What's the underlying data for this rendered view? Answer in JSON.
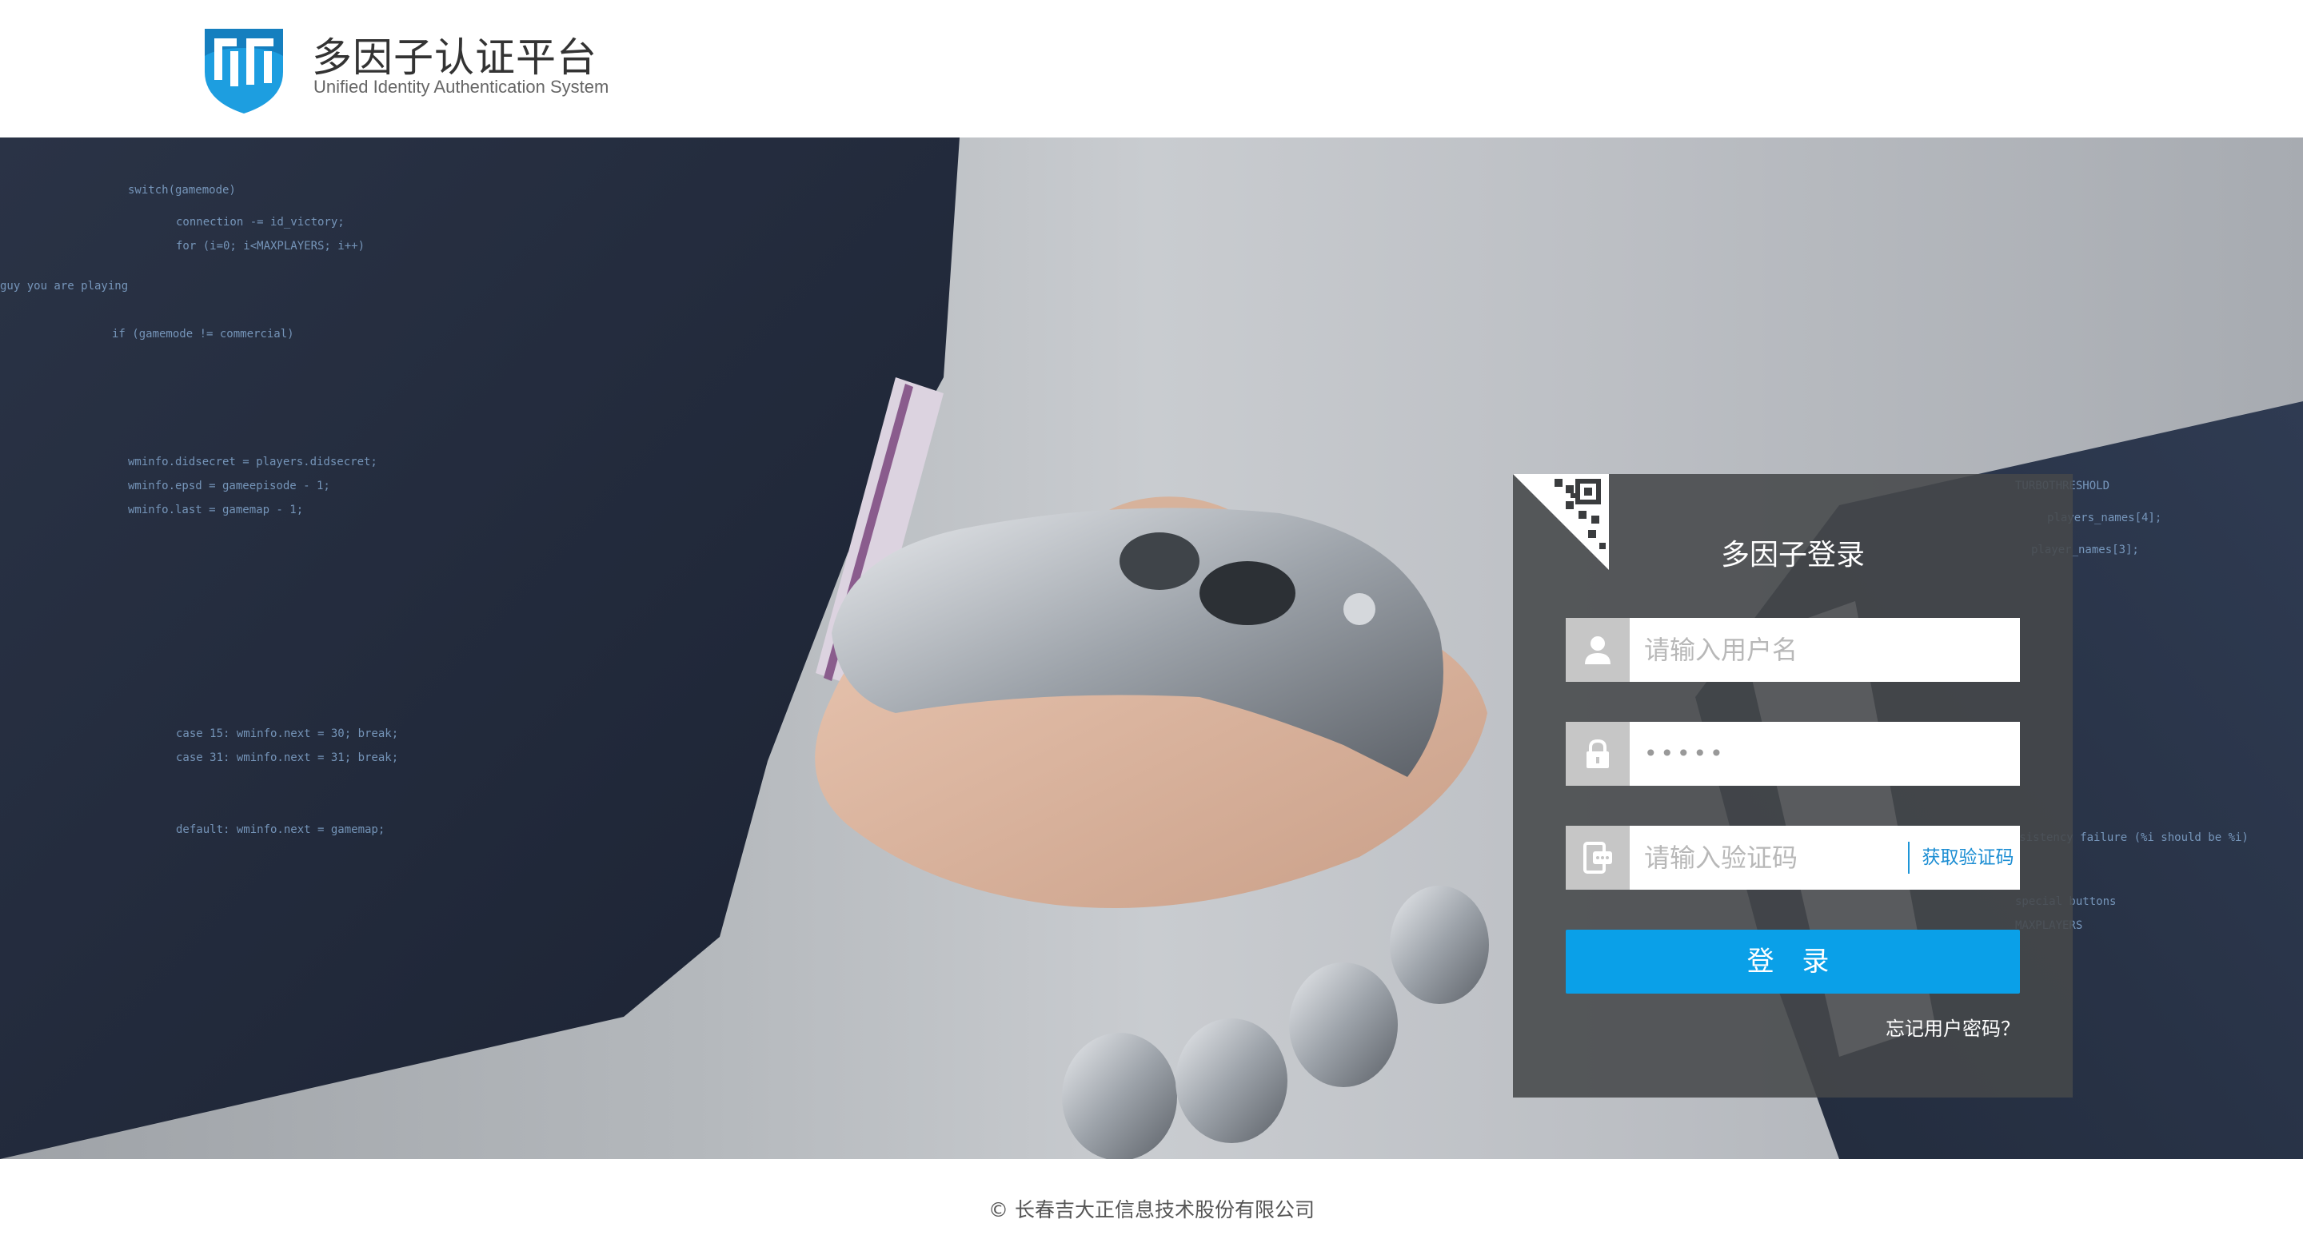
{
  "header": {
    "title": "多因子认证平台",
    "subtitle": "Unified Identity Authentication System",
    "logo_icon": "shield-logo-icon",
    "logo_color": "#1d9ee0"
  },
  "login": {
    "title": "多因子登录",
    "username_placeholder": "请输入用户名",
    "password_value": "•••••",
    "code_placeholder": "请输入验证码",
    "get_code_label": "获取验证码",
    "submit_label": "登 录",
    "forgot_label": "忘记用户密码？",
    "accent_color": "#0aa0e8"
  },
  "carousel": {
    "slides": 4,
    "active_index": 0
  },
  "footer": {
    "copyright": "© 长春吉大正信息技术股份有限公司"
  }
}
